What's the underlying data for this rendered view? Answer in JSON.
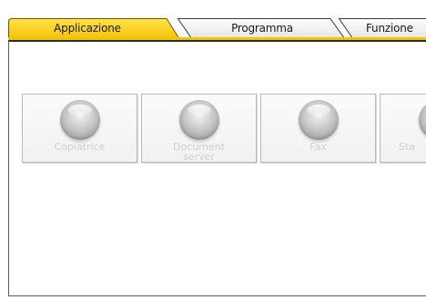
{
  "tabs": [
    {
      "label": "Applicazione",
      "active": true
    },
    {
      "label": "Programma",
      "active": false
    },
    {
      "label": "Funzione",
      "active": false
    }
  ],
  "apps": [
    {
      "label": "Copiatrice",
      "enabled": false
    },
    {
      "label": "Document\nserver",
      "enabled": false
    },
    {
      "label": "Fax",
      "enabled": false
    },
    {
      "label": "Sta",
      "enabled": false
    }
  ],
  "colors": {
    "active_tab": "#f7c400",
    "inactive_tab": "#ededed",
    "disabled_text": "#cfcfcf"
  }
}
